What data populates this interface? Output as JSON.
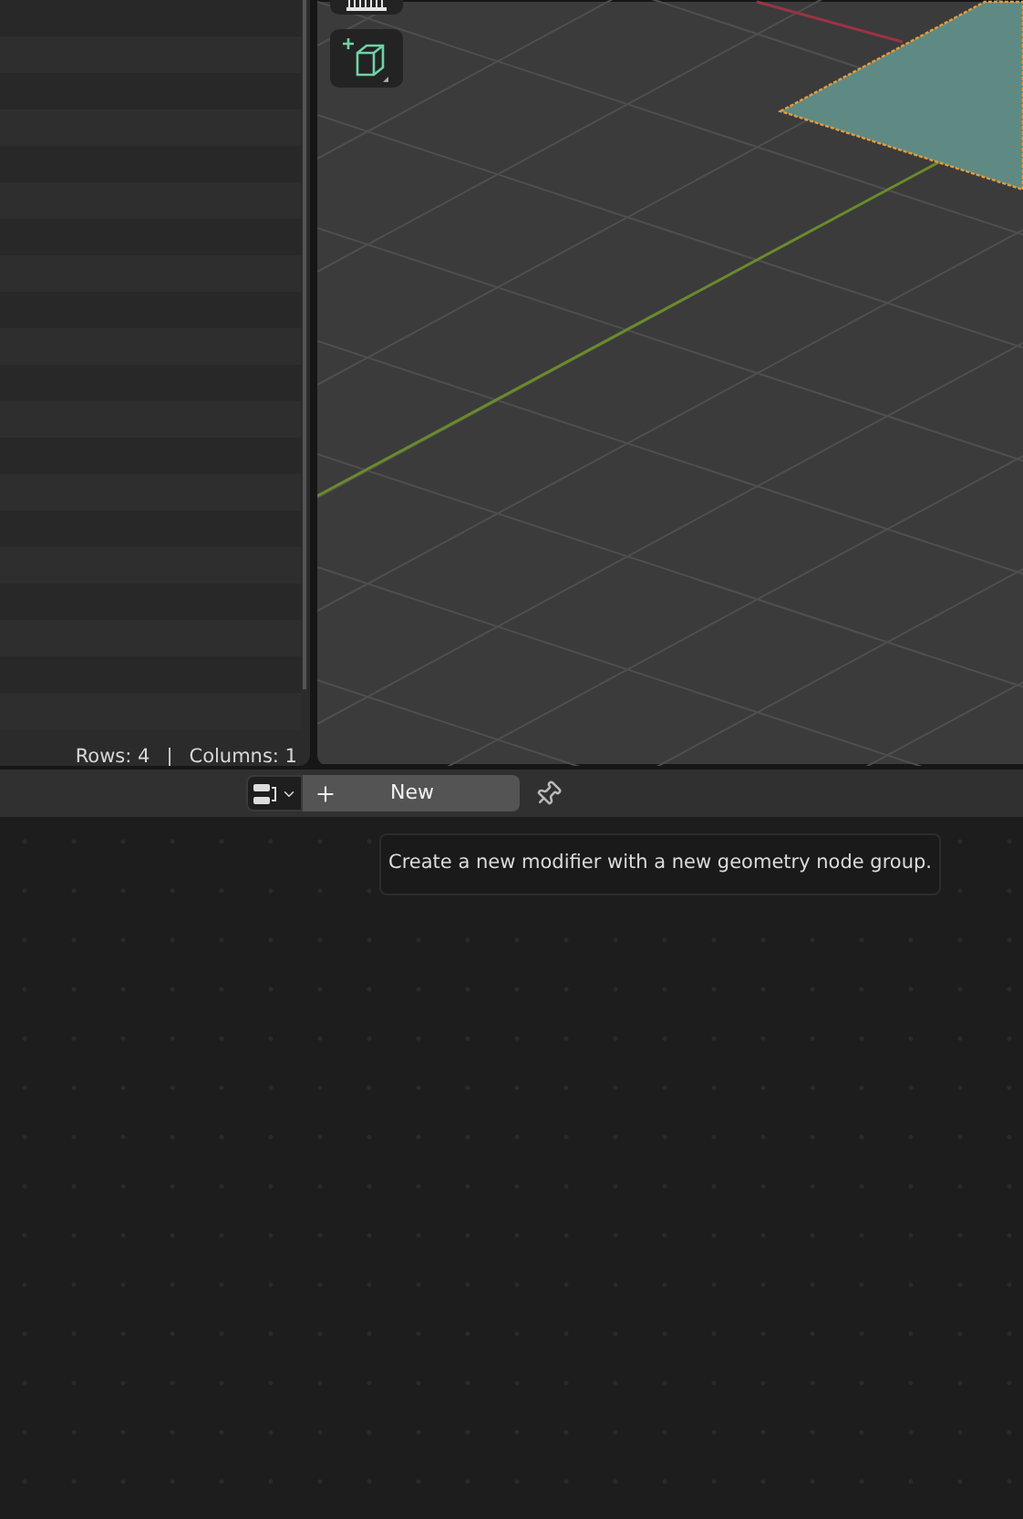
{
  "spreadsheet": {
    "status": {
      "rows": "Rows: 4",
      "separator": "|",
      "columns": "Columns: 1"
    }
  },
  "viewport": {
    "tools": [
      {
        "kind": "measure"
      },
      {
        "kind": "add-cube"
      }
    ]
  },
  "node_editor": {
    "header": {
      "new_button": "New"
    },
    "tooltip": "Create a new modifier with a new geometry node group."
  }
}
